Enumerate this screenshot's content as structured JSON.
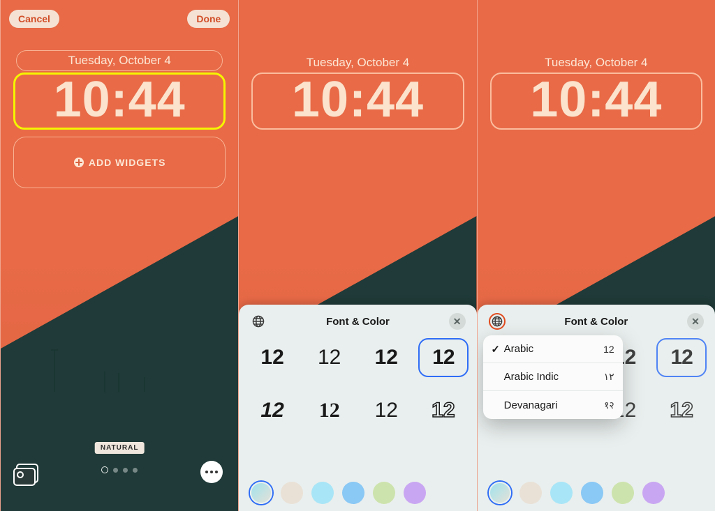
{
  "buttons": {
    "cancel": "Cancel",
    "done": "Done"
  },
  "date": "Tuesday, October 4",
  "time_display": "10:44",
  "add_widgets": "ADD WIDGETS",
  "wallpaper_mode": "NATURAL",
  "sheet": {
    "title": "Font & Color",
    "font_samples": [
      "12",
      "12",
      "12",
      "12",
      "12",
      "12",
      "12",
      "12"
    ]
  },
  "colors": [
    "#c7e6e3",
    "#e9e1d6",
    "#a8e5f7",
    "#8ac8f5",
    "#cde3ad",
    "#c9a6f2"
  ],
  "language_menu": {
    "items": [
      {
        "label": "Arabic",
        "sample": "12",
        "checked": true
      },
      {
        "label": "Arabic Indic",
        "sample": "١٢",
        "checked": false
      },
      {
        "label": "Devanagari",
        "sample": "१२",
        "checked": false
      }
    ]
  }
}
